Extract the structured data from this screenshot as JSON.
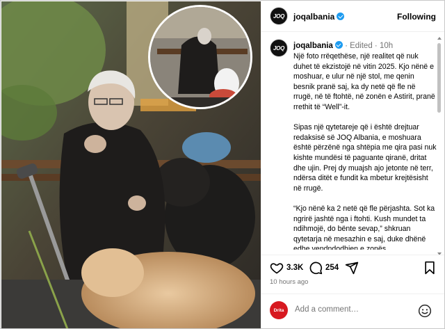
{
  "header": {
    "username": "joqalbania",
    "avatar_text": "JOQ",
    "follow_label": "Following"
  },
  "caption": {
    "username": "joqalbania",
    "edited": "· Edited ·",
    "age": "10h",
    "paragraphs": [
      "Një foto rrëqethëse, një realitet që nuk duhet të ekzistojë në vitin 2025. Kjo nënë e moshuar, e ulur në një stol, me qenin besnik pranë saj, ka dy netë që fle në rrugë, në të ftohtë, në zonën e Astirit, pranë rrethit të “Well”-it.",
      "Sipas një qytetareje që i është drejtuar redaksisë së JOQ Albania, e moshuara është përzënë nga shtëpia me qira pasi nuk kishte mundësi të paguante qiranë, dritat dhe ujin. Prej dy muajsh ajo jetonte në terr, ndërsa ditët e fundit ka mbetur krejtësisht në rrugë.",
      "“Kjo nënë ka 2 netë që fle përjashta. Sot ka ngrirë jashtë nga i ftohti. Kush mundet ta ndihmojë, do bënte sevap,” shkruan qytetarja në mesazhin e saj, duke dhënë edhe vendndodhjen e zonës."
    ]
  },
  "actions": {
    "likes": "3.3K",
    "comments": "254",
    "timestamp": "10 hours ago"
  },
  "comment_box": {
    "placeholder": "Add a comment…",
    "avatar_text": "Drita"
  },
  "icons": {
    "like": "heart-icon",
    "comment": "speech-bubble-icon",
    "share": "paper-plane-icon",
    "save": "bookmark-icon",
    "emoji": "smiley-face-icon",
    "verified": "verified-badge-icon"
  },
  "colors": {
    "verified": "#1d9bf0",
    "muted_text": "#737373",
    "commenter_avatar": "#d71920"
  }
}
